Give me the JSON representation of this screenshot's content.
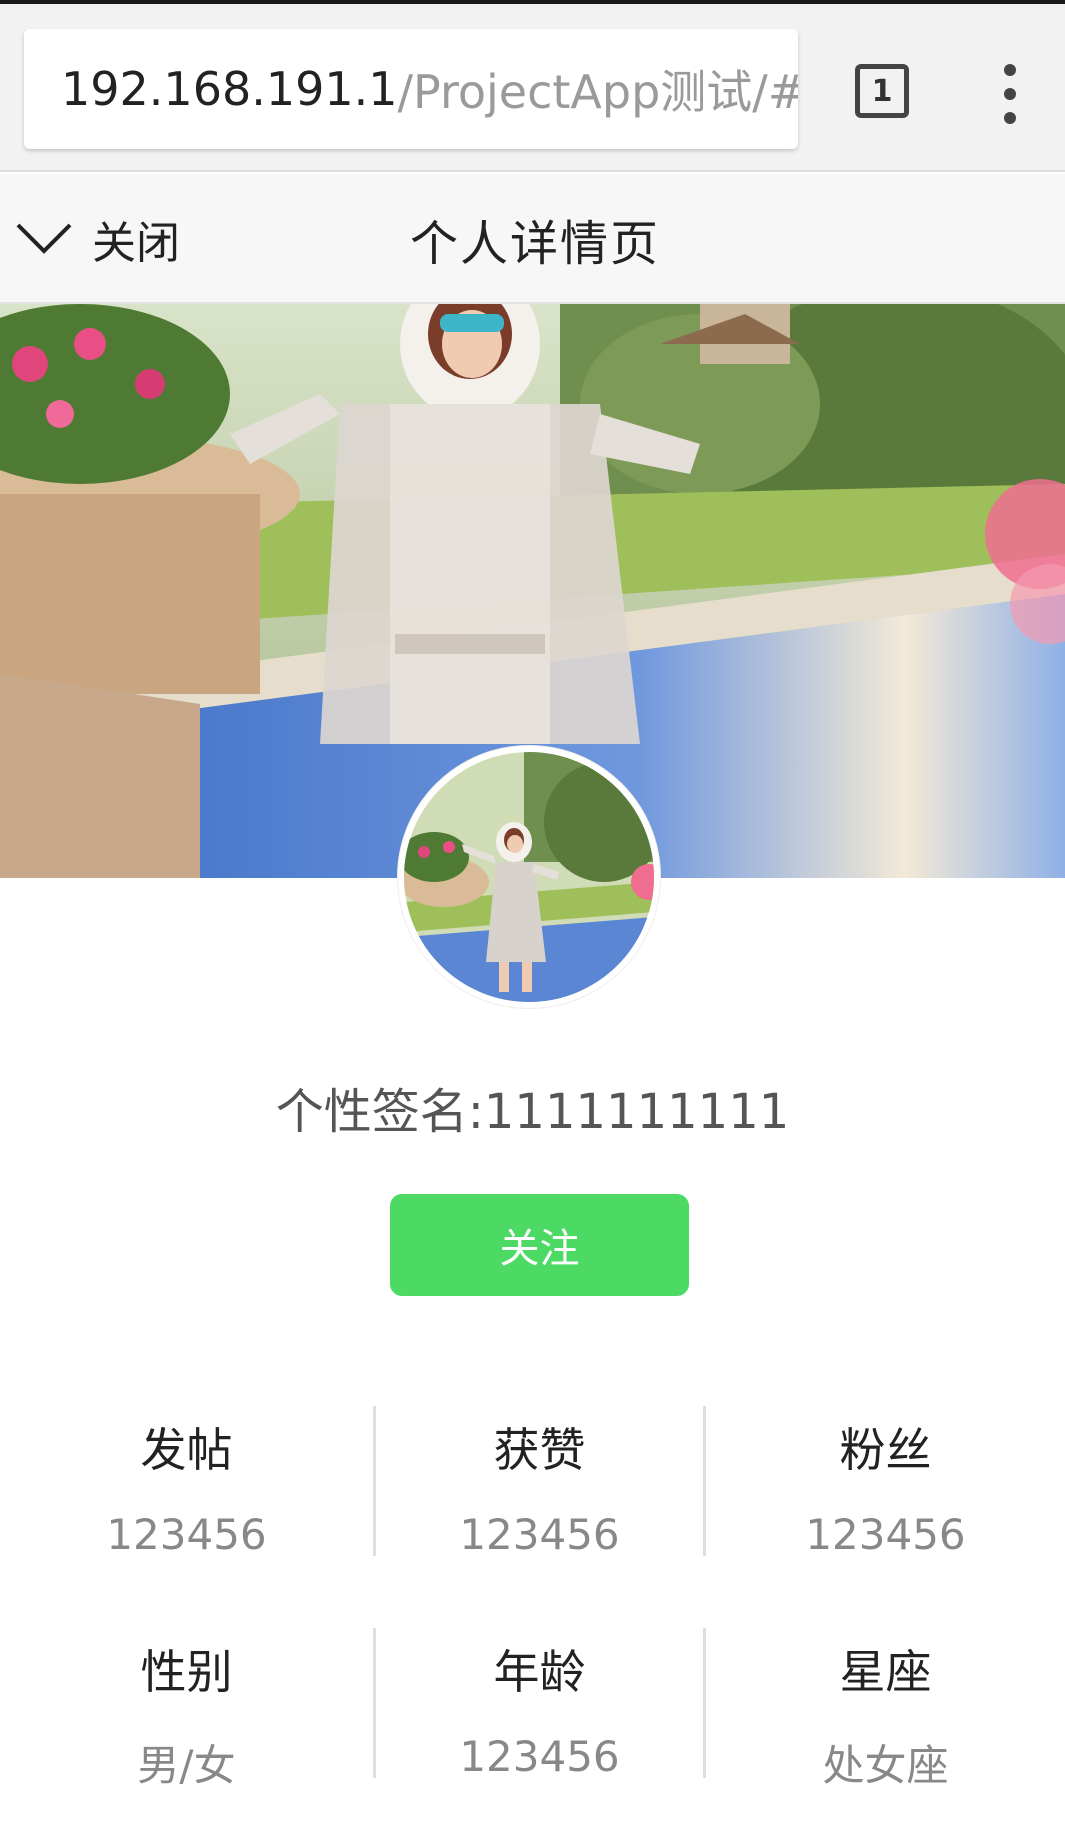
{
  "browser": {
    "url_host": "192.168.191.1",
    "url_path": "/ProjectApp测试/#",
    "tab_count": "1"
  },
  "header": {
    "close_label": "关闭",
    "title": "个人详情页"
  },
  "profile": {
    "signature": "个性签名:1111111111",
    "follow_label": "关注"
  },
  "stats": {
    "row1": [
      {
        "label": "发帖",
        "value": "123456"
      },
      {
        "label": "获赞",
        "value": "123456"
      },
      {
        "label": "粉丝",
        "value": "123456"
      }
    ],
    "row2": [
      {
        "label": "性别",
        "value": "男/女"
      },
      {
        "label": "年龄",
        "value": "123456"
      },
      {
        "label": "星座",
        "value": "处女座"
      }
    ]
  },
  "colors": {
    "follow_button": "#4cd964",
    "header_bg": "#f7f7f7",
    "browser_bg": "#f2f2f2"
  },
  "icons": {
    "close": "chevron-down-icon",
    "tabs": "tab-switcher-icon",
    "menu": "more-vert-icon"
  }
}
